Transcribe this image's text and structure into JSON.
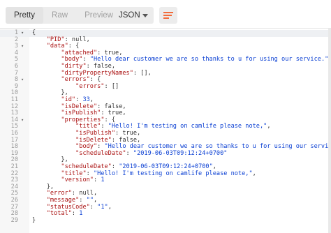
{
  "toolbar": {
    "tabs": [
      {
        "label": "Pretty",
        "active": true
      },
      {
        "label": "Raw",
        "active": false
      },
      {
        "label": "Preview",
        "active": false
      }
    ],
    "format": "JSON",
    "accent": "#f26b3a"
  },
  "editor": {
    "lines": [
      {
        "n": "1",
        "fold": true,
        "text": "{"
      },
      {
        "n": "2",
        "fold": false,
        "text": "    \"PID\": null,"
      },
      {
        "n": "3",
        "fold": true,
        "text": "    \"data\": {"
      },
      {
        "n": "4",
        "fold": false,
        "text": "        \"attached\": true,"
      },
      {
        "n": "5",
        "fold": false,
        "text": "        \"body\": \"Hello dear customer we are so thanks to u for using our service.\","
      },
      {
        "n": "6",
        "fold": false,
        "text": "        \"dirty\": false,"
      },
      {
        "n": "7",
        "fold": false,
        "text": "        \"dirtyPropertyNames\": [],"
      },
      {
        "n": "8",
        "fold": true,
        "text": "        \"errors\": {"
      },
      {
        "n": "9",
        "fold": false,
        "text": "            \"errors\": []"
      },
      {
        "n": "10",
        "fold": false,
        "text": "        },"
      },
      {
        "n": "11",
        "fold": false,
        "text": "        \"id\": 33,"
      },
      {
        "n": "12",
        "fold": false,
        "text": "        \"isDelete\": false,"
      },
      {
        "n": "13",
        "fold": false,
        "text": "        \"isPublish\": true,"
      },
      {
        "n": "14",
        "fold": true,
        "text": "        \"properties\": {"
      },
      {
        "n": "15",
        "fold": false,
        "text": "            \"title\": \"Hello! I'm testing on camlife please note,\","
      },
      {
        "n": "16",
        "fold": false,
        "text": "            \"isPublish\": true,"
      },
      {
        "n": "17",
        "fold": false,
        "text": "            \"isDelete\": false,"
      },
      {
        "n": "18",
        "fold": false,
        "text": "            \"body\": \"Hello dear customer we are so thanks to u for using our service.\","
      },
      {
        "n": "19",
        "fold": false,
        "text": "            \"scheduleDate\": \"2019-06-03T09:12:24+0700\""
      },
      {
        "n": "20",
        "fold": false,
        "text": "        },"
      },
      {
        "n": "21",
        "fold": false,
        "text": "        \"scheduleDate\": \"2019-06-03T09:12:24+0700\","
      },
      {
        "n": "22",
        "fold": false,
        "text": "        \"title\": \"Hello! I'm testing on camlife please note,\","
      },
      {
        "n": "23",
        "fold": false,
        "text": "        \"version\": 1"
      },
      {
        "n": "24",
        "fold": false,
        "text": "    },"
      },
      {
        "n": "25",
        "fold": false,
        "text": "    \"error\": null,"
      },
      {
        "n": "26",
        "fold": false,
        "text": "    \"message\": \"\","
      },
      {
        "n": "27",
        "fold": false,
        "text": "    \"statusCode\": \"1\","
      },
      {
        "n": "28",
        "fold": false,
        "text": "    \"total\": 1"
      },
      {
        "n": "29",
        "fold": false,
        "text": "}"
      }
    ]
  }
}
